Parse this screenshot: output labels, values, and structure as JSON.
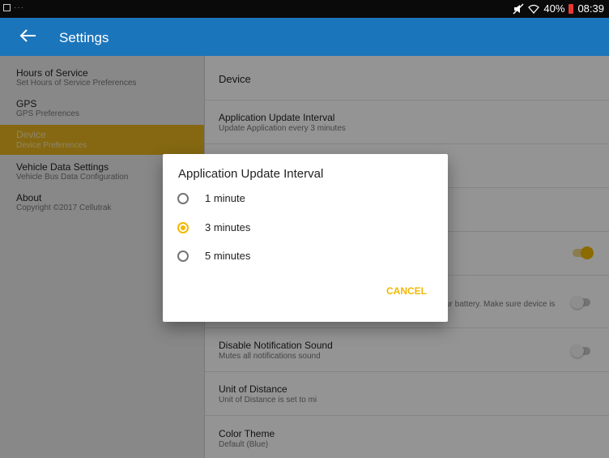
{
  "status_bar": {
    "battery": "40%",
    "time": "08:39",
    "icons": [
      "screenshot-icon",
      "notification-dots-icon",
      "mute-icon",
      "wifi-icon",
      "battery-low-icon"
    ]
  },
  "app_bar": {
    "title": "Settings"
  },
  "sidebar": {
    "items": [
      {
        "title": "Hours of Service",
        "subtitle": "Set Hours of Service Preferences"
      },
      {
        "title": "GPS",
        "subtitle": "GPS Preferences"
      },
      {
        "title": "Device",
        "subtitle": "Device Preferences",
        "selected": true
      },
      {
        "title": "Vehicle Data Settings",
        "subtitle": "Vehicle Bus Data Configuration"
      },
      {
        "title": "About",
        "subtitle": "Copyright ©2017 Cellutrak"
      }
    ]
  },
  "content": {
    "header": "Device",
    "rows": [
      {
        "title": "Application Update Interval",
        "subtitle": "Update Application every 3 minutes"
      },
      {
        "title": "",
        "subtitle": ""
      },
      {
        "title": "",
        "subtitle": ""
      },
      {
        "title": "",
        "subtitle": "",
        "toggle": "on"
      },
      {
        "title": "",
        "subtitle": "ur battery. Make sure device is",
        "toggle": "off"
      },
      {
        "title": "Disable Notification Sound",
        "subtitle": "Mutes all notifications sound",
        "toggle": "off"
      },
      {
        "title": "Unit of Distance",
        "subtitle": "Unit of Distance is set to mi"
      },
      {
        "title": "Color Theme",
        "subtitle": "Default (Blue)"
      }
    ]
  },
  "dialog": {
    "title": "Application Update Interval",
    "options": [
      {
        "label": "1 minute",
        "checked": false
      },
      {
        "label": "3 minutes",
        "checked": true
      },
      {
        "label": "5 minutes",
        "checked": false
      }
    ],
    "cancel_label": "CANCEL"
  },
  "colors": {
    "app_bar": "#1b75bb",
    "accent": "#f2b800",
    "selected_item": "#e6b31e",
    "sidebar_bg": "#eaeaea"
  }
}
